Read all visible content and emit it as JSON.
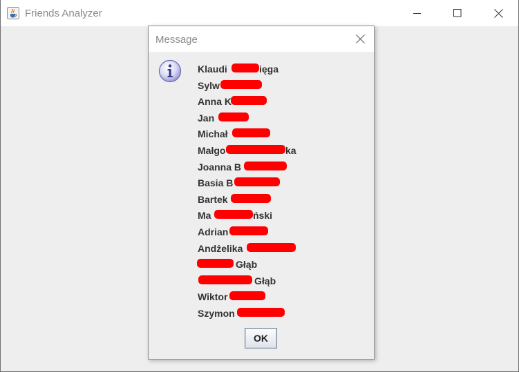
{
  "window": {
    "title": "Friends Analyzer",
    "icon": "java-cup-icon",
    "controls": [
      "minimize",
      "maximize",
      "close"
    ]
  },
  "dialog": {
    "title": "Message",
    "icon": "info-icon",
    "ok_label": "OK",
    "names": [
      {
        "a": "Klaudi",
        "b": "ięga"
      },
      {
        "a": "Sylw",
        "b": ""
      },
      {
        "a": "Anna K",
        "b": ""
      },
      {
        "a": "Jan",
        "b": ""
      },
      {
        "a": "Michał",
        "b": ""
      },
      {
        "a": "Małgo",
        "b": "ka"
      },
      {
        "a": "Joanna B",
        "b": ""
      },
      {
        "a": "Basia B",
        "b": ""
      },
      {
        "a": "Bartek",
        "b": ""
      },
      {
        "a": "Ma",
        "b": "ński"
      },
      {
        "a": "Adrian",
        "b": ""
      },
      {
        "a": "Andżelika",
        "b": ""
      },
      {
        "a": "",
        "b": "Głąb"
      },
      {
        "a": "",
        "b": "Głąb"
      },
      {
        "a": "Wiktor",
        "b": ""
      },
      {
        "a": "Szymon",
        "b": ""
      }
    ]
  },
  "colors": {
    "redaction": "#ff0000",
    "titlebar": "#ffffff",
    "background": "#eeeeee"
  }
}
